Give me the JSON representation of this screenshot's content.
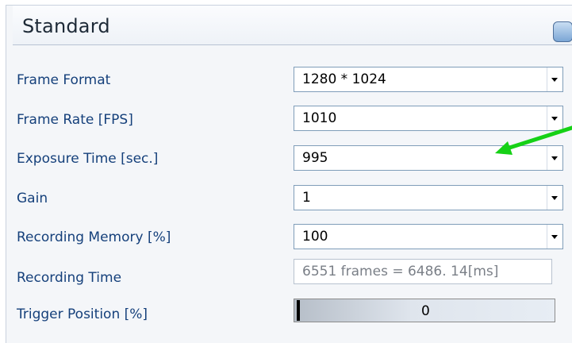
{
  "panel": {
    "title": "Standard",
    "controls": [
      {
        "label": "Frame Format",
        "value": "1280 * 1024",
        "type": "dropdown"
      },
      {
        "label": " Frame Rate [FPS]",
        "value": "1010",
        "type": "dropdown"
      },
      {
        "label": "Exposure Time [sec.]",
        "value": "995",
        "type": "dropdown"
      },
      {
        "label": "Gain",
        "value": "1",
        "type": "dropdown"
      },
      {
        "label": "Recording Memory [%]",
        "value": "100",
        "type": "dropdown"
      },
      {
        "label": "Recording Time",
        "value": "6551 frames = 6486. 14[ms]",
        "type": "readonly"
      },
      {
        "label": "Trigger Position [%]",
        "value": "0",
        "type": "slider",
        "level": 0
      }
    ]
  },
  "annotation": {
    "arrow_color": "#16d116"
  },
  "icons": {
    "collapse": "collapse-button-icon",
    "dropdown": "chevron-down-icon"
  },
  "colors": {
    "label": "#15407b",
    "panel_bg": "#f4f6f9",
    "field_border": "#7f9db9"
  }
}
